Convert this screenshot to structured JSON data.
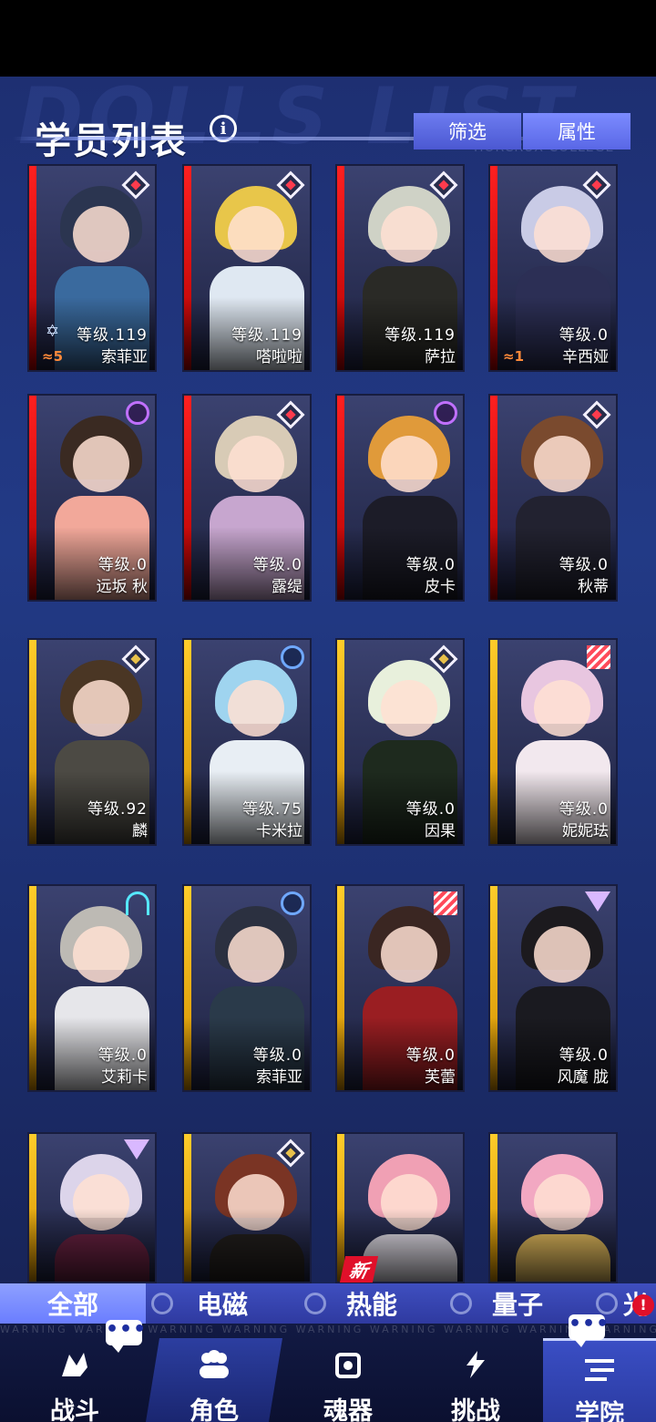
{
  "header": {
    "title": "学员列表",
    "info_icon": "info-icon",
    "watermark": "DOLLS LIST",
    "watermark_sub": "HORCRUX COLLEGE",
    "filter_label": "筛选",
    "attribute_label": "属性"
  },
  "cards": [
    {
      "level": "等级.119",
      "name": "索菲亚",
      "frame": "red",
      "badge": "diamond-red-icon",
      "extra_star": "✡",
      "rank": "≈5",
      "colors": {
        "hair": "#2b3550",
        "body": "#3a6a9e"
      }
    },
    {
      "level": "等级.119",
      "name": "嗒啦啦",
      "frame": "red",
      "badge": "diamond-red-icon",
      "extra_star": "",
      "rank": "",
      "colors": {
        "hair": "#e8c64a",
        "body": "#dfe8f2"
      }
    },
    {
      "level": "等级.119",
      "name": "萨拉",
      "frame": "red",
      "badge": "diamond-red-icon",
      "extra_star": "",
      "rank": "",
      "colors": {
        "hair": "#cfd2c6",
        "body": "#2a2a26"
      }
    },
    {
      "level": "等级.0",
      "name": "辛西娅",
      "frame": "red",
      "badge": "diamond-red-icon",
      "extra_star": "",
      "rank": "≈1",
      "colors": {
        "hair": "#c9cbe6",
        "body": "#2c2f55"
      }
    },
    {
      "level": "等级.0",
      "name": "远坂 秋",
      "frame": "red",
      "badge": "swirl-icon",
      "extra_star": "",
      "rank": "",
      "colors": {
        "hair": "#3a2a22",
        "body": "#f2a89a"
      }
    },
    {
      "level": "等级.0",
      "name": "露缇",
      "frame": "red",
      "badge": "diamond-red-icon",
      "extra_star": "",
      "rank": "",
      "colors": {
        "hair": "#d8cbb6",
        "body": "#c7a6cf"
      }
    },
    {
      "level": "等级.0",
      "name": "皮卡",
      "frame": "red",
      "badge": "swirl-icon",
      "extra_star": "",
      "rank": "",
      "colors": {
        "hair": "#e09a3a",
        "body": "#1c1c28"
      }
    },
    {
      "level": "等级.0",
      "name": "秋蒂",
      "frame": "red",
      "badge": "diamond-red-icon",
      "extra_star": "",
      "rank": "",
      "colors": {
        "hair": "#7a4a2e",
        "body": "#222230"
      }
    },
    {
      "level": "等级.92",
      "name": "麟",
      "frame": "gold",
      "badge": "diamond-gold-icon",
      "extra_star": "",
      "rank": "",
      "colors": {
        "hair": "#4a3624",
        "body": "#4c4a44"
      }
    },
    {
      "level": "等级.75",
      "name": "卡米拉",
      "frame": "gold",
      "badge": "ring-icon",
      "extra_star": "",
      "rank": "",
      "colors": {
        "hair": "#9fd4ef",
        "body": "#e8eef4"
      }
    },
    {
      "level": "等级.0",
      "name": "因果",
      "frame": "gold",
      "badge": "diamond-gold-icon",
      "extra_star": "",
      "rank": "",
      "colors": {
        "hair": "#e8f0dc",
        "body": "#1e2a1e"
      }
    },
    {
      "level": "等级.0",
      "name": "妮妮珐",
      "frame": "gold",
      "badge": "stripes-icon",
      "extra_star": "",
      "rank": "",
      "colors": {
        "hair": "#e8c6e0",
        "body": "#f2e8ee"
      }
    },
    {
      "level": "等级.0",
      "name": "艾莉卡",
      "frame": "gold",
      "badge": "wifi-icon",
      "extra_star": "",
      "rank": "",
      "colors": {
        "hair": "#bdbab4",
        "body": "#e6e6ea"
      }
    },
    {
      "level": "等级.0",
      "name": "索菲亚",
      "frame": "gold",
      "badge": "ring-icon",
      "extra_star": "",
      "rank": "",
      "colors": {
        "hair": "#2b3040",
        "body": "#2a3a4a"
      }
    },
    {
      "level": "等级.0",
      "name": "芙蕾",
      "frame": "gold",
      "badge": "stripes-icon",
      "extra_star": "",
      "rank": "",
      "colors": {
        "hair": "#3a2622",
        "body": "#9a1e22"
      }
    },
    {
      "level": "等级.0",
      "name": "风魔 胧",
      "frame": "gold",
      "badge": "triangle-icon",
      "extra_star": "",
      "rank": "",
      "colors": {
        "hair": "#1c1a1e",
        "body": "#1a1a20"
      }
    },
    {
      "level": "",
      "name": "",
      "frame": "gold",
      "badge": "triangle-icon",
      "extra_star": "",
      "rank": "",
      "colors": {
        "hair": "#dcd4ea",
        "body": "#6a2242"
      }
    },
    {
      "level": "",
      "name": "",
      "frame": "gold",
      "badge": "diamond-gold-icon",
      "extra_star": "",
      "rank": "",
      "colors": {
        "hair": "#7a3424",
        "body": "#24201e"
      }
    },
    {
      "level": "",
      "name": "",
      "frame": "gold",
      "badge": "",
      "extra_star": "",
      "rank": "",
      "colors": {
        "hair": "#f0a0b4",
        "body": "#e8e4ee"
      }
    },
    {
      "level": "",
      "name": "",
      "frame": "gold",
      "badge": "",
      "extra_star": "",
      "rank": "",
      "colors": {
        "hair": "#f2a8c2",
        "body": "#e8c060"
      }
    }
  ],
  "tabs": [
    {
      "label": "全部",
      "active": true
    },
    {
      "label": "电磁",
      "active": false
    },
    {
      "label": "热能",
      "active": false
    },
    {
      "label": "量子",
      "active": false
    },
    {
      "label": "光",
      "active": false
    }
  ],
  "nav": {
    "warning_text": "WARNING   WARNING   WARNING   WARNING   WARNING   WARNING   WARNING   WARNING   WARNING",
    "items": [
      {
        "label": "战斗",
        "icon": "battle-icon"
      },
      {
        "label": "角色",
        "icon": "characters-icon"
      },
      {
        "label": "魂器",
        "icon": "soul-vessel-icon"
      },
      {
        "label": "挑战",
        "icon": "challenge-icon"
      },
      {
        "label": "学院",
        "icon": "academy-icon"
      }
    ],
    "new_badge": "新",
    "chat_dots": "•••",
    "alert_mark": "!"
  }
}
